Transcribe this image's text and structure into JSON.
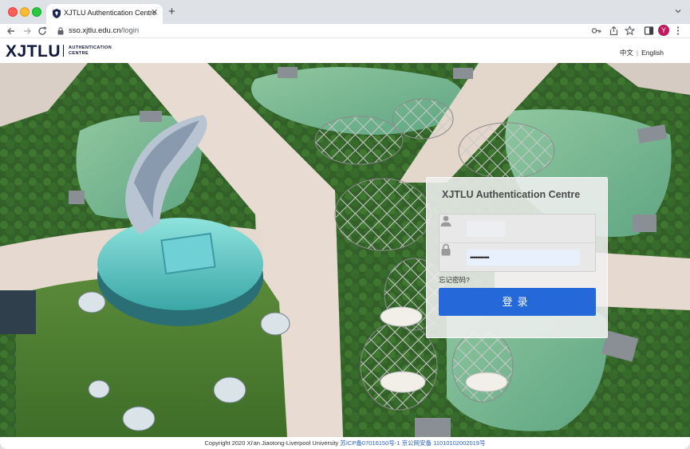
{
  "browser": {
    "tab_title": "XJTLU Authentication Centre",
    "url_host": "sso.xjtlu.edu.cn",
    "url_path": "/login",
    "avatar_letter": "Y",
    "new_tab_glyph": "+",
    "close_glyph": "✕",
    "icons": [
      "shield-icon",
      "back-icon",
      "forward-icon",
      "reload-icon",
      "lock-icon",
      "key-icon",
      "share-icon",
      "star-icon",
      "side-panel-icon",
      "kebab-menu-icon",
      "tab-search-icon"
    ]
  },
  "site": {
    "logo": "XJTLU",
    "logo_sub_line1": "AUTHENTICATION",
    "logo_sub_line2": "CENTRE",
    "lang_chinese": "中文",
    "lang_separator": "|",
    "lang_english": "English"
  },
  "login": {
    "title": "XJTLU Authentication Centre",
    "username_value": "",
    "password_value": "•••••••••••",
    "forgot_label": "忘记密码?",
    "submit_label": "登录",
    "icons": [
      "user-icon",
      "padlock-icon"
    ]
  },
  "footer": {
    "copyright": "Copyright 2020 Xi'an Jiaotong-Liverpool University",
    "icp": "苏ICP备07016150号-1",
    "police": "京公网安备 11010102002019号"
  },
  "colors": {
    "brand_navy": "#10173c",
    "button_blue": "#2468d9",
    "link_blue": "#2a62c9"
  }
}
